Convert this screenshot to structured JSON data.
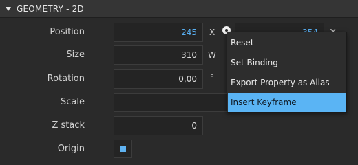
{
  "section": {
    "title": "GEOMETRY - 2D"
  },
  "position": {
    "label": "Position",
    "x_value": "245",
    "x_unit": "X",
    "y_value": "354",
    "y_unit": "Y"
  },
  "size": {
    "label": "Size",
    "w_value": "310",
    "w_unit": "W"
  },
  "rotation": {
    "label": "Rotation",
    "value": "0,00",
    "unit": "°"
  },
  "scale": {
    "label": "Scale"
  },
  "zstack": {
    "label": "Z stack",
    "value": "0"
  },
  "origin": {
    "label": "Origin"
  },
  "context_menu": {
    "items": [
      "Reset",
      "Set Binding",
      "Export Property as Alias",
      "Insert Keyframe"
    ],
    "highlighted": "Insert Keyframe"
  },
  "colors": {
    "accent": "#5ab4f4",
    "value_blue": "#58aef0",
    "background": "#2a2a2a"
  }
}
